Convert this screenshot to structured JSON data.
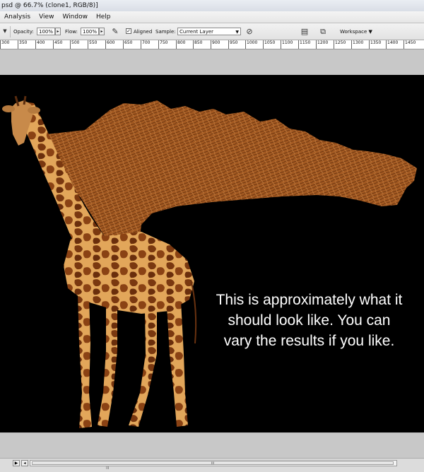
{
  "window": {
    "title": "psd @ 66.7% (clone1, RGB/8)]"
  },
  "menu": {
    "items": [
      "Analysis",
      "View",
      "Window",
      "Help"
    ]
  },
  "options": {
    "opacity_label": "Opacity:",
    "opacity_value": "100%",
    "flow_label": "Flow:",
    "flow_value": "100%",
    "aligned_label": "Aligned",
    "aligned_checked": true,
    "sample_label": "Sample:",
    "sample_value": "Current Layer",
    "workspace_label": "Workspace ▼"
  },
  "ruler": {
    "ticks": [
      "300",
      "350",
      "400",
      "450",
      "500",
      "550",
      "600",
      "650",
      "700",
      "750",
      "800",
      "850",
      "900",
      "950",
      "1000",
      "1050",
      "1100",
      "1150",
      "1200",
      "1250",
      "1300",
      "1350",
      "1400",
      "1450"
    ]
  },
  "canvas": {
    "background": "#000000",
    "caption": [
      "This is approximately what it",
      "should look like. You can",
      "vary the results if you like."
    ]
  },
  "scrollbar": {
    "thumb_grip": "III"
  },
  "status": {
    "grip": "III"
  },
  "icons": {
    "opacity_arrow": "arrow-right-icon",
    "flow_arrow": "arrow-right-icon",
    "airbrush": "airbrush-icon",
    "sample_dropdown": "chevron-down-icon",
    "ignore_adjustment": "ignore-adjustment-layers-icon",
    "palette_well": "palette-well-icon",
    "workspace": "workspace-icon"
  }
}
